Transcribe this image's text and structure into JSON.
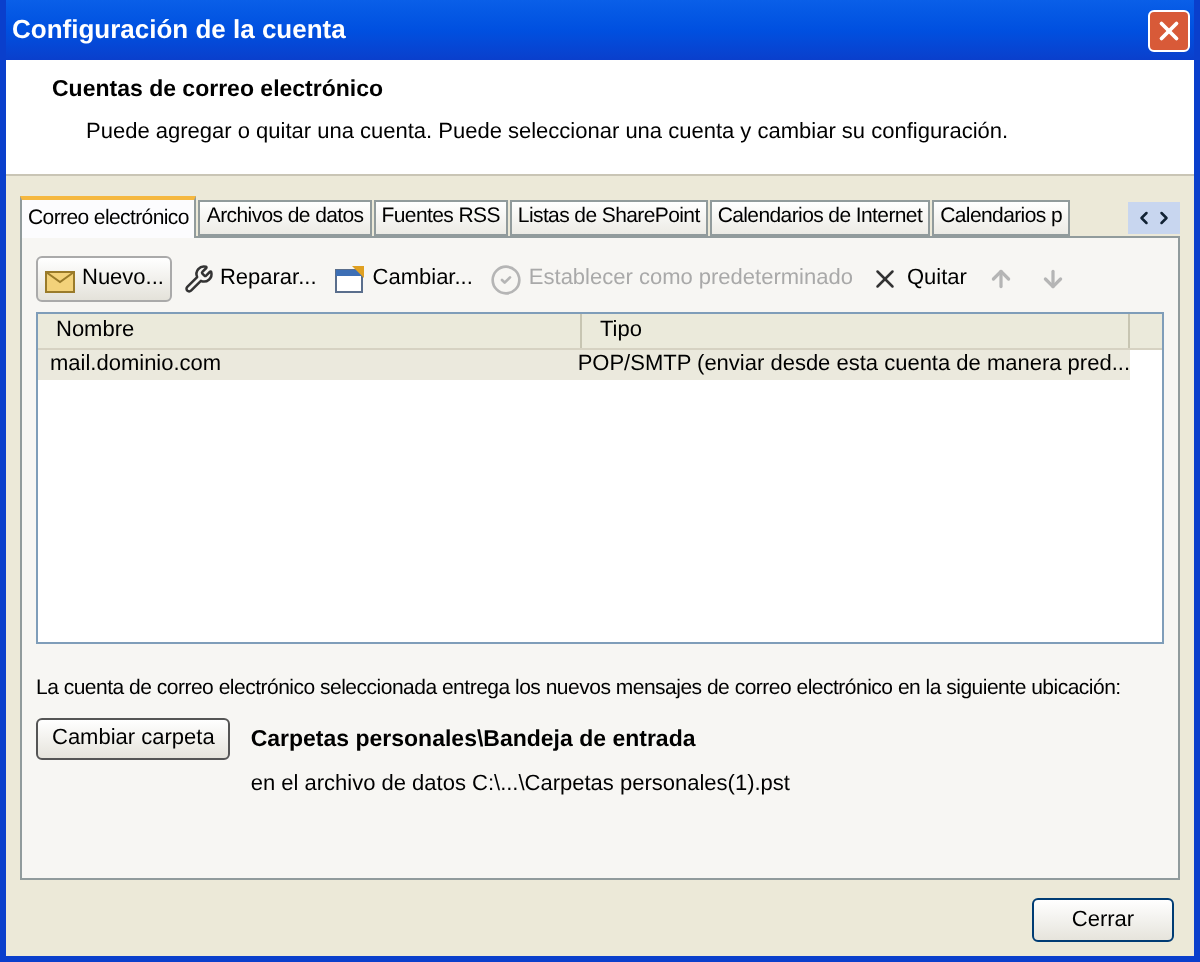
{
  "window": {
    "title": "Configuración de la cuenta"
  },
  "header": {
    "title": "Cuentas de correo electrónico",
    "subtitle": "Puede agregar o quitar una cuenta. Puede seleccionar una cuenta y cambiar su configuración."
  },
  "tabs": [
    {
      "label": "Correo electrónico",
      "selected": true
    },
    {
      "label": "Archivos de datos",
      "selected": false
    },
    {
      "label": "Fuentes RSS",
      "selected": false
    },
    {
      "label": "Listas de SharePoint",
      "selected": false
    },
    {
      "label": "Calendarios de Internet",
      "selected": false
    },
    {
      "label": "Calendarios p",
      "selected": false
    }
  ],
  "toolbar": [
    {
      "kind": "new",
      "label": "Nuevo...",
      "disabled": false
    },
    {
      "kind": "repair",
      "label": "Reparar...",
      "disabled": false
    },
    {
      "kind": "change",
      "label": "Cambiar...",
      "disabled": false
    },
    {
      "kind": "default",
      "label": "Establecer como predeterminado",
      "disabled": true
    },
    {
      "kind": "remove",
      "label": "Quitar",
      "disabled": false
    },
    {
      "kind": "up",
      "disabled": true
    },
    {
      "kind": "down",
      "disabled": true
    }
  ],
  "table": {
    "columns": [
      "Nombre",
      "Tipo"
    ],
    "rows": [
      {
        "cells": [
          "mail.dominio.com",
          "POP/SMTP (enviar desde esta cuenta de manera pred..."
        ],
        "selected": true
      }
    ]
  },
  "delivery": {
    "text": "La cuenta de correo electrónico seleccionada entrega los nuevos mensajes de correo electrónico en la siguiente ubicación:",
    "button": "Cambiar carpeta",
    "folder": "Carpetas personales\\Bandeja de entrada",
    "file": "en el archivo de datos C:\\...\\Carpetas personales(1).pst"
  },
  "buttons": [
    "Cerrar"
  ]
}
